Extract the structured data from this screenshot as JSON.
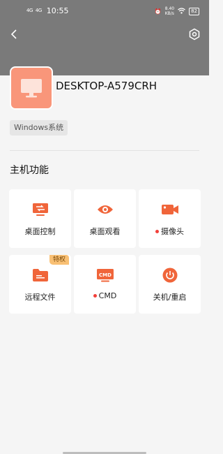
{
  "status_bar": {
    "signal_1": "4G",
    "signal_2": "4G",
    "time": "10:55",
    "speed": "8.40\nKB/s",
    "battery": "82"
  },
  "device": {
    "name": "DESKTOP-A579CRH",
    "os_badge": "Windows系统"
  },
  "section": {
    "title": "主机功能"
  },
  "functions": [
    {
      "label": "桌面控制",
      "icon": "desktop-control-icon",
      "dot": false,
      "tag": ""
    },
    {
      "label": "桌面观看",
      "icon": "eye-icon",
      "dot": false,
      "tag": ""
    },
    {
      "label": "摄像头",
      "icon": "camera-icon",
      "dot": true,
      "tag": ""
    },
    {
      "label": "远程文件",
      "icon": "folder-icon",
      "dot": false,
      "tag": "特权"
    },
    {
      "label": "CMD",
      "icon": "cmd-icon",
      "dot": true,
      "tag": ""
    },
    {
      "label": "关机/重启",
      "icon": "power-icon",
      "dot": false,
      "tag": ""
    }
  ],
  "colors": {
    "accent": "#f0653a",
    "avatar_bg": "#f9967a",
    "header_bg": "#7a7a7a",
    "dot": "#f2403a",
    "tag_bg": "#f9c074"
  }
}
